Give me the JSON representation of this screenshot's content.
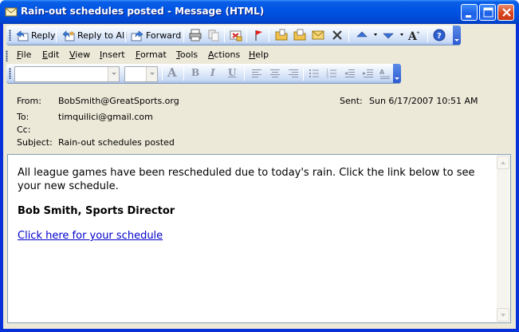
{
  "window": {
    "title": "Rain-out schedules posted - Message (HTML)",
    "title_bar_color": "#0054e3",
    "controls": [
      "minimize-icon",
      "maximize-icon",
      "close-icon"
    ]
  },
  "toolbar": {
    "reply": "Reply",
    "reply_all": "Reply to All",
    "forward": "Forward",
    "icons": [
      "print-icon",
      "copy-icon",
      "move-to-folder-icon",
      "flag-icon",
      "open-folder-icon",
      "categorize-icon",
      "mark-envelope-icon",
      "delete-icon",
      "previous-item-icon",
      "next-item-icon",
      "font-size-icon",
      "help-icon"
    ]
  },
  "menu": {
    "items": [
      "File",
      "Edit",
      "View",
      "Insert",
      "Format",
      "Tools",
      "Actions",
      "Help"
    ]
  },
  "format_toolbar": {
    "style_value": "",
    "size_value": "",
    "font_color_glyph": "A",
    "bold_glyph": "B",
    "italic_glyph": "I",
    "underline_glyph": "U",
    "icons": [
      "align-left-icon",
      "center-icon",
      "align-right-icon",
      "bullets-icon",
      "numbering-icon",
      "decrease-indent-icon",
      "increase-indent-icon",
      "formatting-icon"
    ]
  },
  "header": {
    "from_label": "From:",
    "from_value": "BobSmith@GreatSports.org",
    "sent_label": "Sent:",
    "sent_value": "Sun 6/17/2007 10:51 AM",
    "to_label": "To:",
    "to_value": "timquilici@gmail.com",
    "cc_label": "Cc:",
    "cc_value": "",
    "subject_label": "Subject:",
    "subject_value": "Rain-out schedules posted"
  },
  "body": {
    "paragraph": "All league games have been rescheduled due to today's rain. Click the link below to see your new schedule.",
    "signature": "Bob Smith, Sports Director",
    "link_text": "Click here for your schedule",
    "link_color": "#0000cc"
  }
}
